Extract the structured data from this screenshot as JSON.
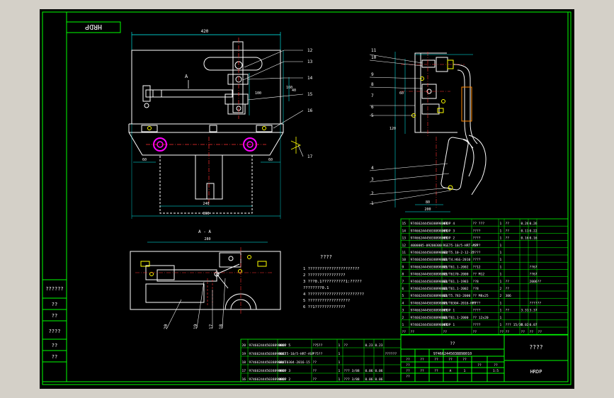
{
  "drawing": {
    "code_box": "HRDP",
    "colors": {
      "background": "#000000",
      "frame": "#00ff00",
      "part": "#ffffff",
      "dimension": "#00ffff",
      "center": "#ff3030",
      "hatch": "#ff00ff",
      "pointer": "#ffff00",
      "table": "#00ff00"
    },
    "front_view": {
      "top_dim": "420",
      "view_label": "A",
      "bottom_dims": [
        "240",
        "360",
        "60",
        "60"
      ],
      "right_dims": [
        "100",
        "160",
        "40"
      ],
      "callouts": [
        "12",
        "13",
        "14",
        "15",
        "16",
        "17"
      ]
    },
    "section_label": "A - A",
    "bottom_view": {
      "top_dim": "280",
      "callouts": [
        "20",
        "19",
        "17",
        "18"
      ]
    },
    "side_view": {
      "left_callouts": [
        "11",
        "10",
        "9",
        "8",
        "7",
        "6",
        "5",
        "4",
        "3",
        "2",
        "1"
      ],
      "dims": [
        "60",
        "120",
        "80",
        "200"
      ]
    },
    "notes": {
      "title": "????",
      "lines": [
        "1 ??????????????????????",
        "2 ????????????????",
        "3 ???0.1??????????1:?????",
        "   ????????0.1",
        "4 ????????????????????????",
        "5 ??????????????????",
        "6 ??1?????????????"
      ]
    },
    "bom_right": {
      "rows": [
        [
          "15",
          "9746624445038898001",
          "HRDP 4",
          "?? ???",
          "1",
          "??",
          "0.26",
          "0.26",
          ""
        ],
        [
          "14",
          "9746624445038898001",
          "HRDP 3",
          "????",
          "1",
          "??",
          "0.11",
          "0.22",
          ""
        ],
        [
          "13",
          "9746624445038898001",
          "HRDP 2",
          "????",
          "1",
          "??",
          "0.16",
          "0.16",
          ""
        ],
        [
          "12",
          "4000005-09200300",
          "RGE75-10/5-HRT-ASP",
          "????",
          "1",
          "",
          "",
          "",
          ""
        ],
        [
          "11",
          "9746624445038898002",
          "GB/T5.10-2-12-35",
          "????",
          "1",
          "",
          "",
          "",
          ""
        ],
        [
          "10",
          "9746624445038898001",
          "GB/T4.HGG-2010",
          "????",
          "1",
          "",
          "",
          "",
          ""
        ],
        [
          "9",
          "9746624445038898001",
          "GB/T61.1-2002",
          "??12",
          "1",
          "",
          "",
          "??67",
          ""
        ],
        [
          "8",
          "9746624445038898001",
          "GB/T6170-2000",
          "?? M12",
          "1",
          "",
          "",
          "??67",
          ""
        ],
        [
          "7",
          "9746624445038898001",
          "GB/T61.1-1983",
          "??8",
          "1",
          "??",
          "",
          "2006??",
          ""
        ],
        [
          "6",
          "9746624445038898001",
          "GB/T61.1-2002",
          "??8",
          "2",
          "??",
          "",
          "",
          ""
        ],
        [
          "5",
          "9746624445038898001",
          "GB/T5.783-2000",
          "?? M8x25",
          "2",
          "306",
          "",
          "",
          ""
        ],
        [
          "4",
          "9746624445038898001",
          "GR/T0304-2016-HRT",
          "????",
          "1",
          "",
          "",
          "??????",
          ""
        ],
        [
          "3",
          "9746624445038898001",
          "HRDP 1",
          "????",
          "1",
          "??",
          "3.31",
          "3.37",
          ""
        ],
        [
          "2",
          "9746624445038898001",
          "GB/T61.1-2000",
          "?? 12x20",
          "1",
          "",
          "",
          "",
          ""
        ],
        [
          "1",
          "9746624445038898001",
          "HRDP 1",
          "????",
          "1",
          "??? 15/35",
          "0.02",
          "0.07",
          ""
        ],
        [
          "??",
          "??",
          "??",
          "??",
          "??",
          "??",
          "??",
          "??",
          "??"
        ]
      ]
    },
    "bom_bottom": {
      "rows": [
        [
          "20",
          "9746624445038898001",
          "HRDP 5",
          "??5??",
          "1",
          "??",
          "0.23",
          "0.23",
          ""
        ],
        [
          "19",
          "9746624445038898001",
          "RGE75-10/5-HRT-ASP",
          "??5??",
          "1",
          "",
          "",
          "",
          "??????"
        ],
        [
          "18",
          "9746624445038898001",
          "GB/T0304-2016-15",
          "??",
          "1",
          "",
          "",
          "",
          ""
        ],
        [
          "17",
          "9746624445038898001",
          "HRDP 3",
          "??",
          "1",
          "??? 3/88",
          "0.06",
          "0.06",
          ""
        ],
        [
          "16",
          "9746624445038898001",
          "HRDP 2",
          "??",
          "1",
          "??? 3/88",
          "0.06",
          "0.06",
          ""
        ]
      ]
    },
    "title_block": {
      "top_label": "??",
      "drawing_no": "974662445038898010",
      "name": "????",
      "code": "HRDP",
      "cells": [
        "??",
        "??",
        "??",
        "??",
        "??",
        "??",
        "??",
        "??",
        "??",
        "??",
        "A",
        "1",
        "??",
        "??",
        "1:5"
      ]
    },
    "side_strip": [
      "??????",
      "??",
      "??",
      "????",
      "??",
      "??"
    ]
  }
}
